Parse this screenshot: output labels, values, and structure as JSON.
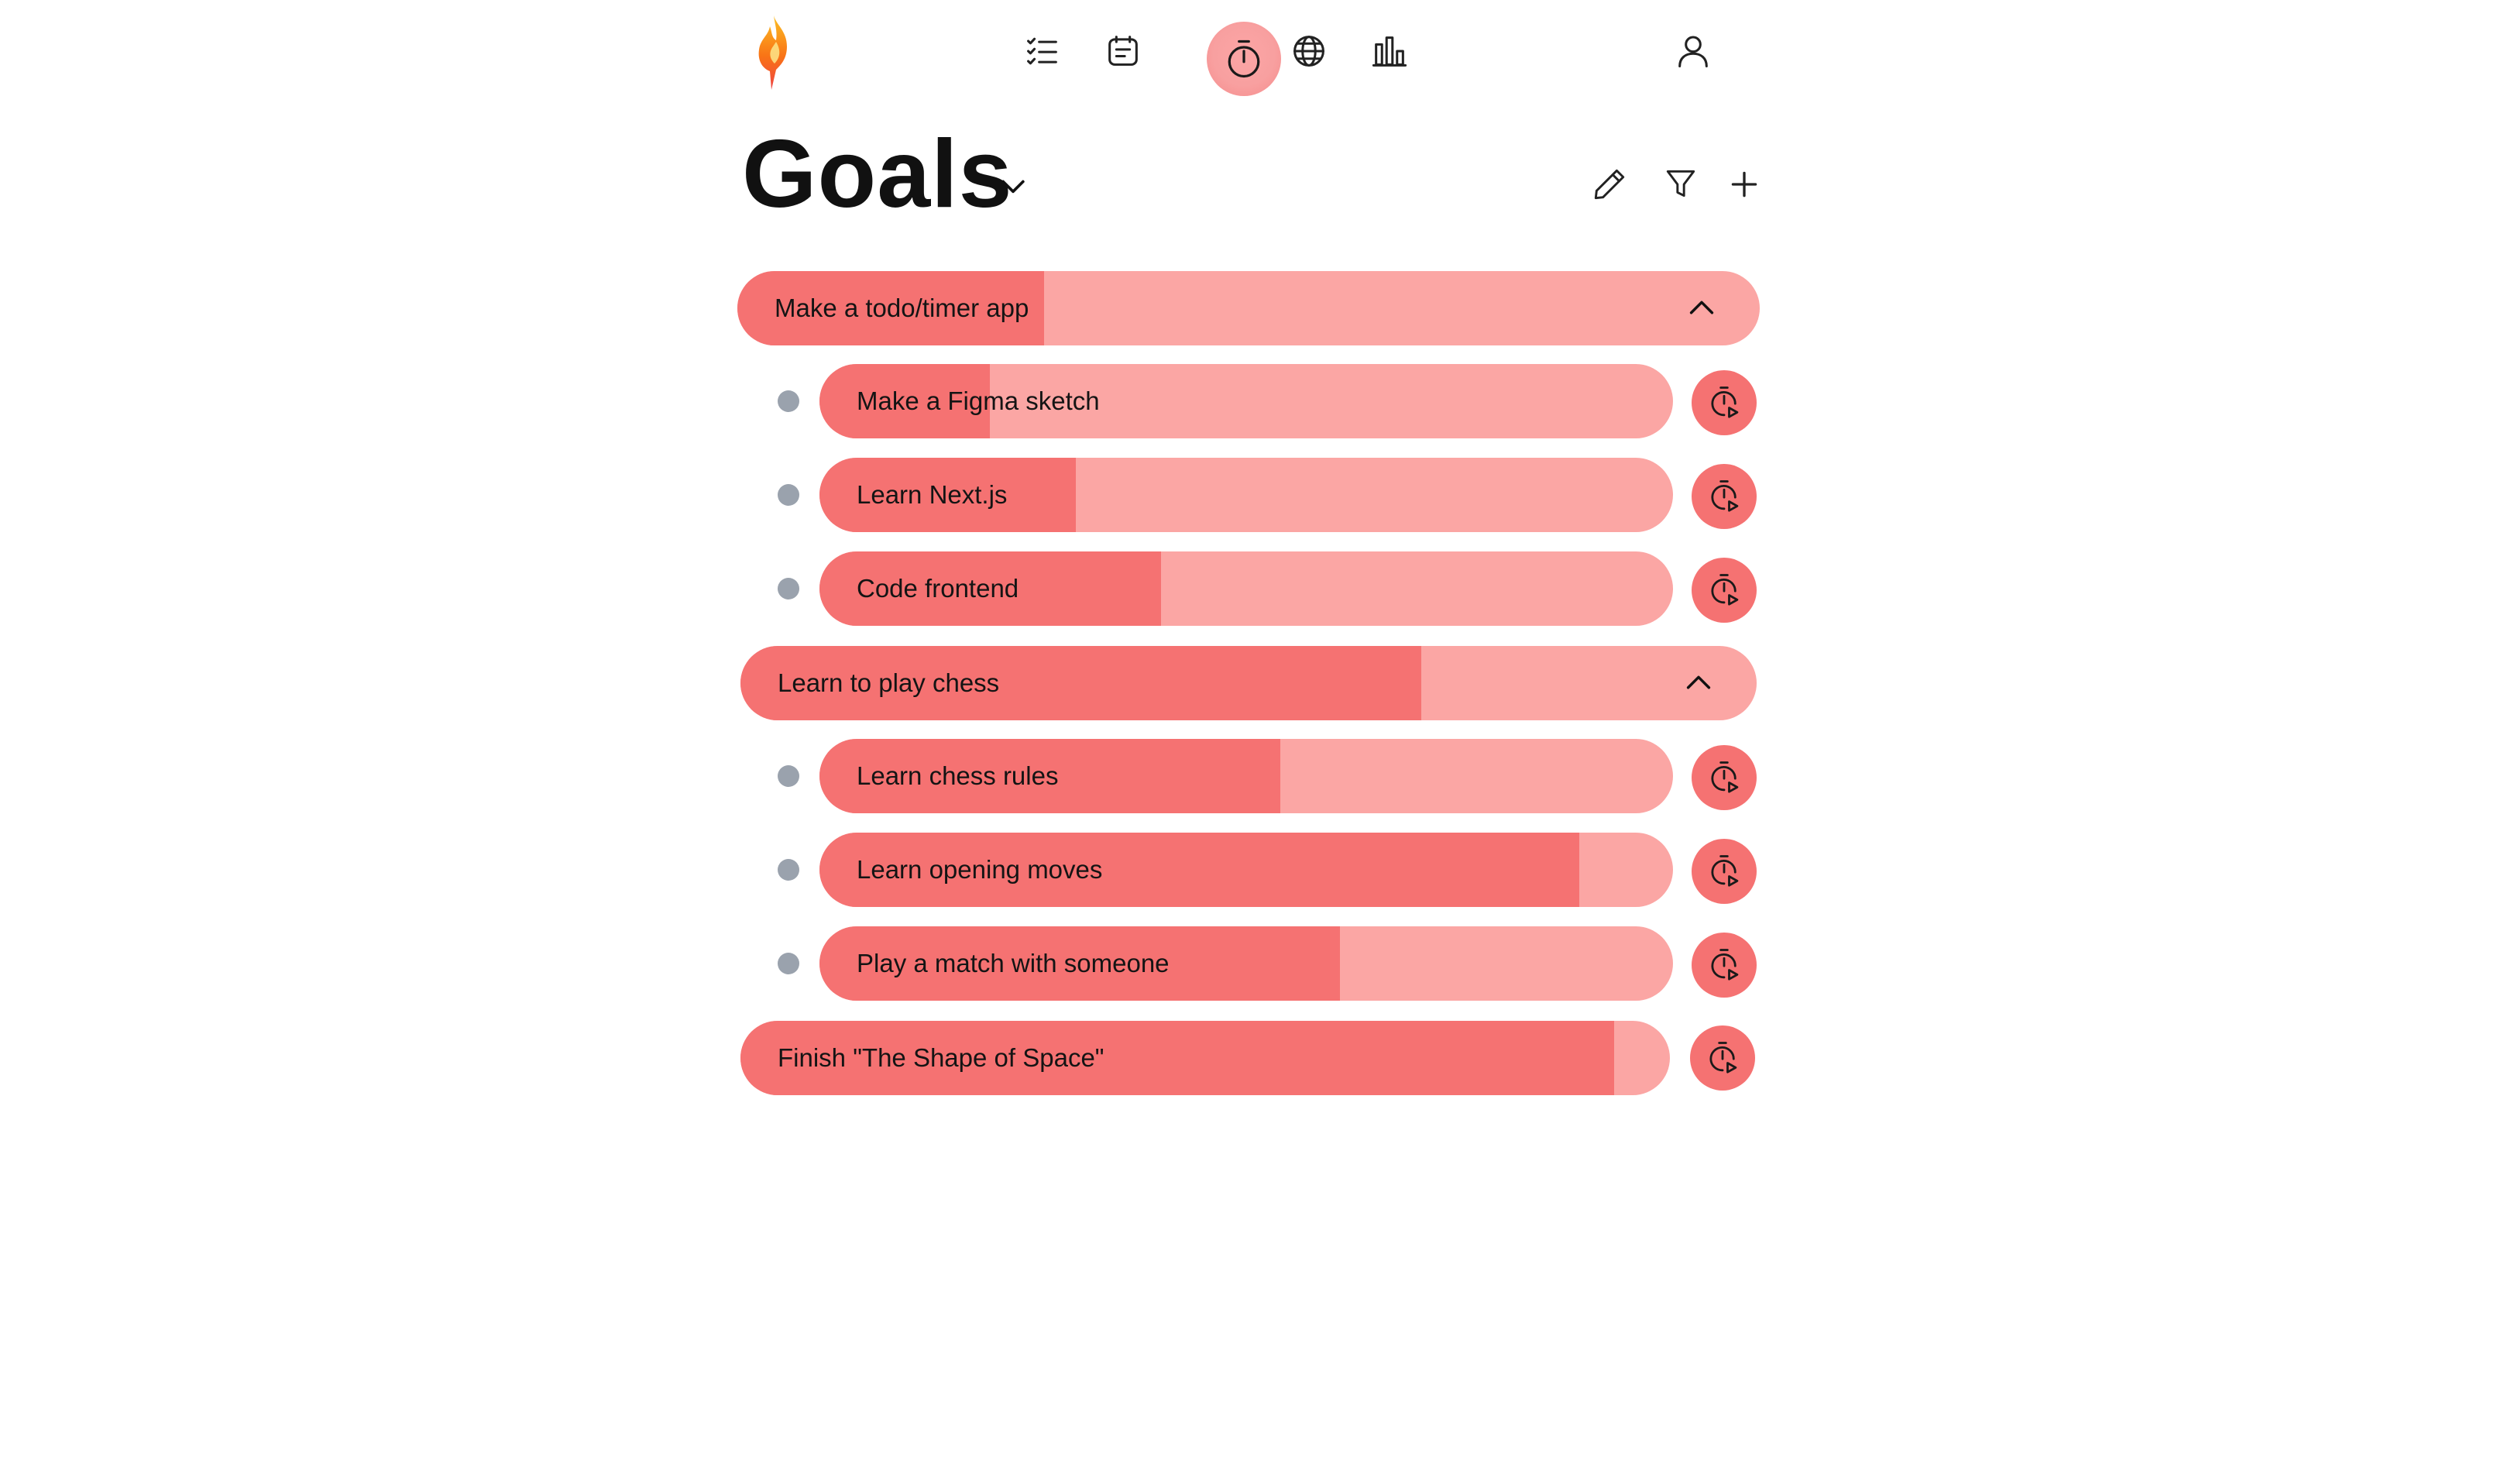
{
  "app": {
    "logo_icon": "flame-logo-icon"
  },
  "nav": {
    "items": [
      {
        "name": "tasks",
        "icon": "checklist-icon"
      },
      {
        "name": "schedule",
        "icon": "calendar-icon"
      },
      {
        "name": "focus",
        "icon": "stopwatch-icon",
        "active": true
      },
      {
        "name": "community",
        "icon": "globe-icon"
      },
      {
        "name": "stats",
        "icon": "bar-chart-icon"
      }
    ],
    "profile_icon": "user-icon"
  },
  "header": {
    "title": "Goals",
    "dropdown_icon": "chevron-down-icon",
    "actions": [
      "pencil-icon",
      "funnel-icon",
      "plus-icon"
    ]
  },
  "colors": {
    "progress": "#f57272",
    "track": "#fba6a4",
    "active_nav": "#f8a0a0",
    "dot": "#9aa2ad"
  },
  "goals": [
    {
      "label": "Make a todo/timer app",
      "progress": 0.3,
      "expanded": true,
      "subgoals": [
        {
          "label": "Make a Figma sketch",
          "progress": 0.2
        },
        {
          "label": "Learn Next.js",
          "progress": 0.3
        },
        {
          "label": "Code frontend",
          "progress": 0.4
        }
      ]
    },
    {
      "label": "Learn to play chess",
      "progress": 0.67,
      "expanded": true,
      "subgoals": [
        {
          "label": "Learn chess rules",
          "progress": 0.54
        },
        {
          "label": "Learn opening moves",
          "progress": 0.89
        },
        {
          "label": "Play a match with someone",
          "progress": 0.61
        }
      ]
    },
    {
      "label": "Finish \"The Shape of Space\"",
      "progress": 0.94
    }
  ]
}
